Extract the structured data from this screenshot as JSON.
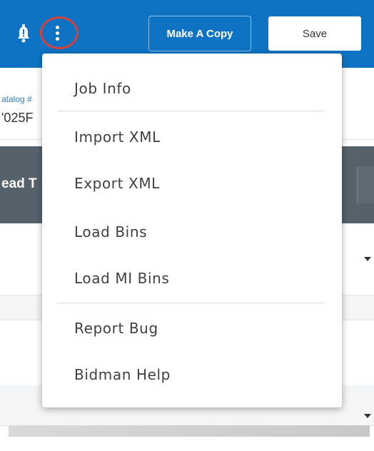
{
  "toolbar": {
    "make_copy_label": "Make A Copy",
    "save_label": "Save",
    "bell_icon": "bell-icon",
    "more_icon": "more-vertical-icon",
    "accent_color": "#0f73c4",
    "highlight_color": "#d3423c"
  },
  "background": {
    "catalog_label": "atalog #",
    "catalog_value": "'025F",
    "section_header": "ead T"
  },
  "menu": {
    "items": [
      {
        "label": "Job Info"
      },
      {
        "label": "Import XML"
      },
      {
        "label": "Export XML"
      },
      {
        "label": "Load Bins"
      },
      {
        "label": "Load MI Bins"
      },
      {
        "label": "Report Bug"
      },
      {
        "label": "Bidman Help"
      }
    ]
  }
}
